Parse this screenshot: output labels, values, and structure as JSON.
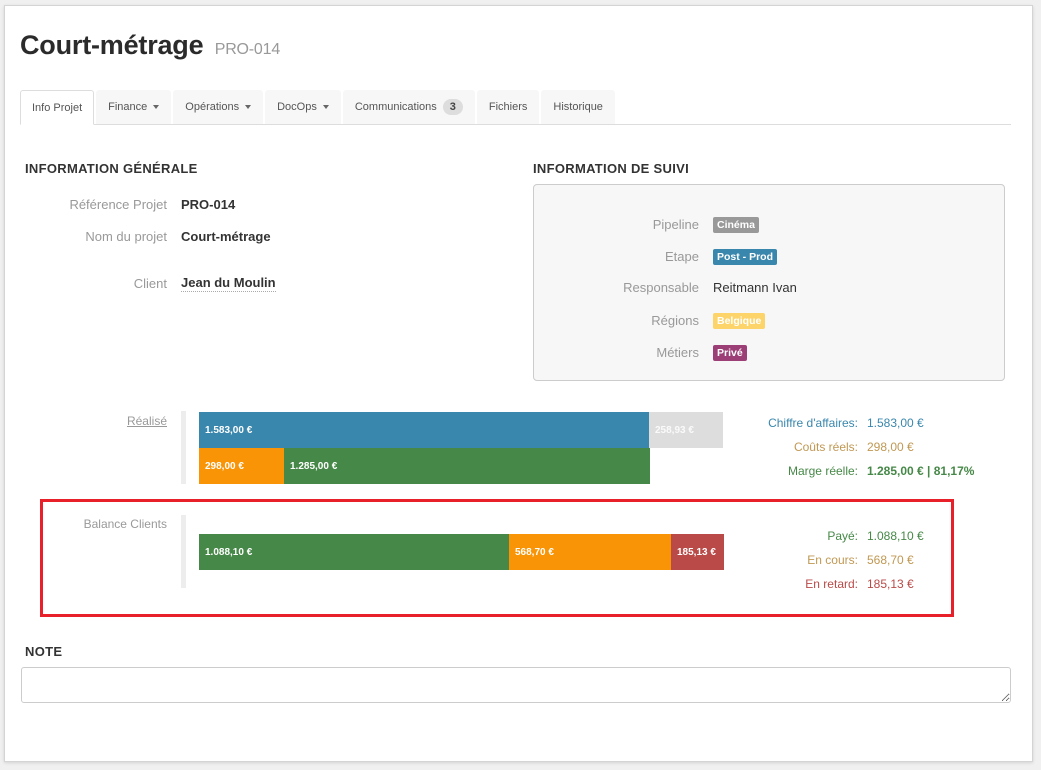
{
  "header": {
    "title": "Court-métrage",
    "subtitle": "PRO-014"
  },
  "tabs": [
    {
      "label": "Info Projet",
      "active": true
    },
    {
      "label": "Finance",
      "dropdown": true
    },
    {
      "label": "Opérations",
      "dropdown": true
    },
    {
      "label": "DocOps",
      "dropdown": true
    },
    {
      "label": "Communications",
      "badge": "3"
    },
    {
      "label": "Fichiers"
    },
    {
      "label": "Historique"
    }
  ],
  "general": {
    "title": "INFORMATION GÉNÉRALE",
    "fields": [
      {
        "label": "Référence Projet",
        "value": "PRO-014"
      },
      {
        "label": "Nom du projet",
        "value": "Court-métrage"
      },
      {
        "label": "Client",
        "value": "Jean du Moulin"
      }
    ]
  },
  "suivi": {
    "title": "INFORMATION DE SUIVI",
    "fields": [
      {
        "label": "Pipeline",
        "value": "Cinéma",
        "tag_color": "#999999"
      },
      {
        "label": "Etape",
        "value": "Post - Prod",
        "tag_color": "#3a87ad"
      },
      {
        "label": "Responsable",
        "value": "Reitmann Ivan"
      },
      {
        "label": "Régions",
        "value": "Belgique",
        "tag_color": "#fcd469"
      },
      {
        "label": "Métiers",
        "value": "Privé",
        "tag_color": "#9d3f77"
      }
    ]
  },
  "realise": {
    "label": "Réalisé",
    "scale_max": 1841.93,
    "row1": [
      {
        "name": "chiffre-affaires",
        "value": 1583.0,
        "text": "1.583,00 €",
        "color": "#3a87ad"
      },
      {
        "name": "remaining",
        "value": 258.93,
        "text": "258,93 €",
        "color": "#dddddd"
      }
    ],
    "row2": [
      {
        "name": "couts-reels",
        "value": 298.0,
        "text": "298,00 €",
        "color": "#f89406"
      },
      {
        "name": "marge-reelle",
        "value": 1285.0,
        "text": "1.285,00 €",
        "color": "#468847"
      }
    ],
    "legend": [
      {
        "label": "Chiffre d'affaires:",
        "value": "1.583,00 €",
        "color": "#3a87ad",
        "bold": false
      },
      {
        "label": "Coûts réels:",
        "value": "298,00 €",
        "color": "#c09853",
        "bold": false
      },
      {
        "label": "Marge réelle:",
        "value": "1.285,00 € | 81,17%",
        "color": "#468847",
        "bold": true
      }
    ]
  },
  "balance": {
    "label": "Balance Clients",
    "scale_max": 1841.93,
    "segments": [
      {
        "name": "paye",
        "value": 1088.1,
        "text": "1.088,10 €",
        "color": "#468847"
      },
      {
        "name": "en-cours",
        "value": 568.7,
        "text": "568,70 €",
        "color": "#f89406"
      },
      {
        "name": "en-retard",
        "value": 185.13,
        "text": "185,13 €",
        "color": "#b94a48"
      }
    ],
    "legend": [
      {
        "label": "Payé:",
        "value": "1.088,10 €",
        "color": "#468847"
      },
      {
        "label": "En cours:",
        "value": "568,70 €",
        "color": "#c09853"
      },
      {
        "label": "En retard:",
        "value": "185,13 €",
        "color": "#b94a48"
      }
    ]
  },
  "note": {
    "title": "NOTE",
    "value": ""
  }
}
